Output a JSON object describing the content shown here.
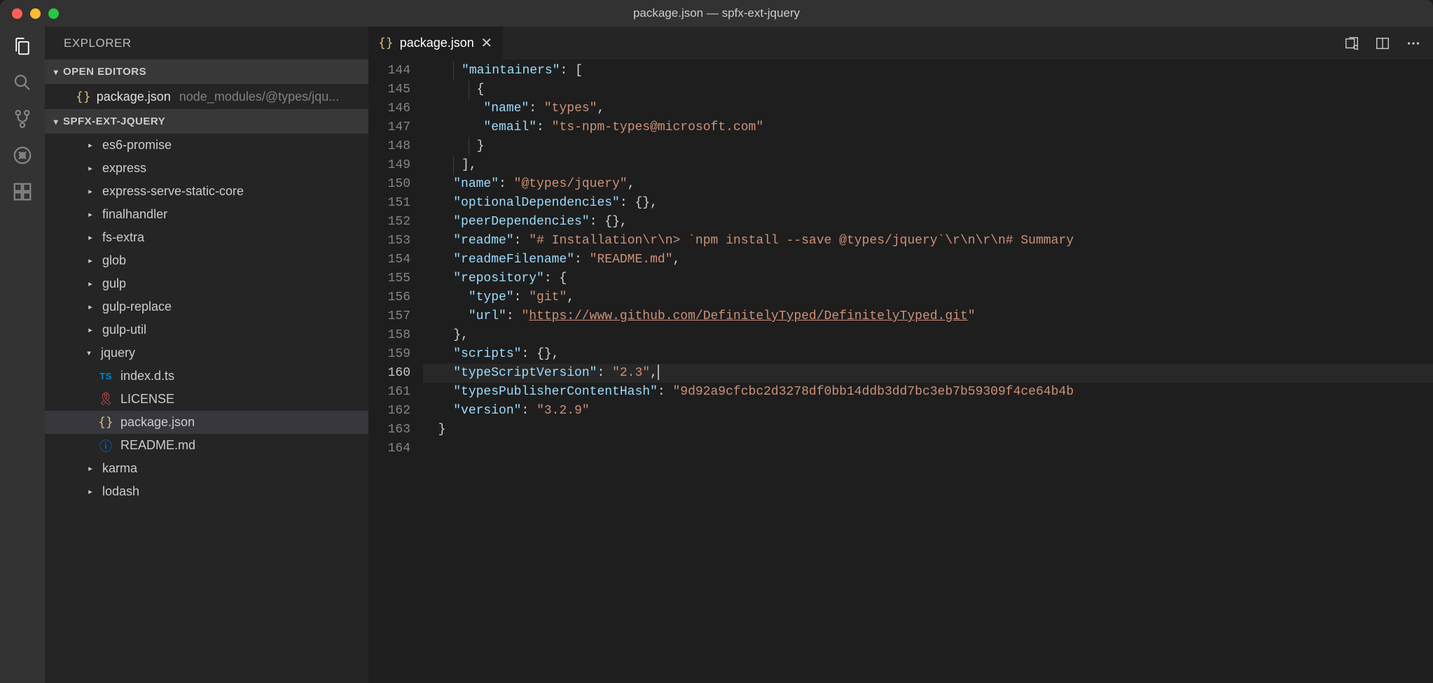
{
  "titlebar": {
    "title": "package.json — spfx-ext-jquery"
  },
  "sidebar": {
    "header": "EXPLORER",
    "openEditorsLabel": "OPEN EDITORS",
    "openEditors": [
      {
        "filename": "package.json",
        "path": "node_modules/@types/jqu..."
      }
    ],
    "projectLabel": "SPFX-EXT-JQUERY",
    "tree": [
      {
        "type": "folder",
        "label": "es6-promise",
        "expanded": false
      },
      {
        "type": "folder",
        "label": "express",
        "expanded": false
      },
      {
        "type": "folder",
        "label": "express-serve-static-core",
        "expanded": false
      },
      {
        "type": "folder",
        "label": "finalhandler",
        "expanded": false
      },
      {
        "type": "folder",
        "label": "fs-extra",
        "expanded": false
      },
      {
        "type": "folder",
        "label": "glob",
        "expanded": false
      },
      {
        "type": "folder",
        "label": "gulp",
        "expanded": false
      },
      {
        "type": "folder",
        "label": "gulp-replace",
        "expanded": false
      },
      {
        "type": "folder",
        "label": "gulp-util",
        "expanded": false
      },
      {
        "type": "folder",
        "label": "jquery",
        "expanded": true
      },
      {
        "type": "file-ts",
        "label": "index.d.ts",
        "selected": false
      },
      {
        "type": "file-license",
        "label": "LICENSE",
        "selected": false
      },
      {
        "type": "file-json",
        "label": "package.json",
        "selected": true
      },
      {
        "type": "file-info",
        "label": "README.md",
        "selected": false
      },
      {
        "type": "folder",
        "label": "karma",
        "expanded": false
      },
      {
        "type": "folder",
        "label": "lodash",
        "expanded": false
      }
    ]
  },
  "tab": {
    "filename": "package.json"
  },
  "editor": {
    "startLine": 144,
    "endLine": 164,
    "currentLine": 160,
    "lines": [
      {
        "n": 144,
        "tokens": [
          {
            "t": "pad",
            "w": 2
          },
          {
            "t": "guide"
          },
          {
            "t": "key",
            "v": "\"maintainers\""
          },
          {
            "t": "punc",
            "v": ":"
          },
          {
            "t": "sp",
            "v": " "
          },
          {
            "t": "punc",
            "v": "["
          }
        ]
      },
      {
        "n": 145,
        "tokens": [
          {
            "t": "pad",
            "w": 3
          },
          {
            "t": "guide"
          },
          {
            "t": "punc",
            "v": "{"
          }
        ]
      },
      {
        "n": 146,
        "tokens": [
          {
            "t": "pad",
            "w": 4
          },
          {
            "t": "key",
            "v": "\"name\""
          },
          {
            "t": "punc",
            "v": ":"
          },
          {
            "t": "sp",
            "v": " "
          },
          {
            "t": "str",
            "v": "\"types\""
          },
          {
            "t": "punc",
            "v": ","
          }
        ]
      },
      {
        "n": 147,
        "tokens": [
          {
            "t": "pad",
            "w": 4
          },
          {
            "t": "key",
            "v": "\"email\""
          },
          {
            "t": "punc",
            "v": ":"
          },
          {
            "t": "sp",
            "v": " "
          },
          {
            "t": "str",
            "v": "\"ts-npm-types@microsoft.com\""
          }
        ]
      },
      {
        "n": 148,
        "tokens": [
          {
            "t": "pad",
            "w": 3
          },
          {
            "t": "guide"
          },
          {
            "t": "punc",
            "v": "}"
          }
        ]
      },
      {
        "n": 149,
        "tokens": [
          {
            "t": "pad",
            "w": 2
          },
          {
            "t": "guide"
          },
          {
            "t": "punc",
            "v": "],"
          }
        ]
      },
      {
        "n": 150,
        "tokens": [
          {
            "t": "pad",
            "w": 2
          },
          {
            "t": "key",
            "v": "\"name\""
          },
          {
            "t": "punc",
            "v": ":"
          },
          {
            "t": "sp",
            "v": " "
          },
          {
            "t": "str",
            "v": "\"@types/jquery\""
          },
          {
            "t": "punc",
            "v": ","
          }
        ]
      },
      {
        "n": 151,
        "tokens": [
          {
            "t": "pad",
            "w": 2
          },
          {
            "t": "key",
            "v": "\"optionalDependencies\""
          },
          {
            "t": "punc",
            "v": ":"
          },
          {
            "t": "sp",
            "v": " "
          },
          {
            "t": "punc",
            "v": "{},"
          }
        ]
      },
      {
        "n": 152,
        "tokens": [
          {
            "t": "pad",
            "w": 2
          },
          {
            "t": "key",
            "v": "\"peerDependencies\""
          },
          {
            "t": "punc",
            "v": ":"
          },
          {
            "t": "sp",
            "v": " "
          },
          {
            "t": "punc",
            "v": "{},"
          }
        ]
      },
      {
        "n": 153,
        "tokens": [
          {
            "t": "pad",
            "w": 2
          },
          {
            "t": "key",
            "v": "\"readme\""
          },
          {
            "t": "punc",
            "v": ":"
          },
          {
            "t": "sp",
            "v": " "
          },
          {
            "t": "str",
            "v": "\"# Installation\\r\\n> `npm install --save @types/jquery`\\r\\n\\r\\n# Summary"
          }
        ]
      },
      {
        "n": 154,
        "tokens": [
          {
            "t": "pad",
            "w": 2
          },
          {
            "t": "key",
            "v": "\"readmeFilename\""
          },
          {
            "t": "punc",
            "v": ":"
          },
          {
            "t": "sp",
            "v": " "
          },
          {
            "t": "str",
            "v": "\"README.md\""
          },
          {
            "t": "punc",
            "v": ","
          }
        ]
      },
      {
        "n": 155,
        "tokens": [
          {
            "t": "pad",
            "w": 2
          },
          {
            "t": "key",
            "v": "\"repository\""
          },
          {
            "t": "punc",
            "v": ":"
          },
          {
            "t": "sp",
            "v": " "
          },
          {
            "t": "punc",
            "v": "{"
          }
        ]
      },
      {
        "n": 156,
        "tokens": [
          {
            "t": "pad",
            "w": 3
          },
          {
            "t": "key",
            "v": "\"type\""
          },
          {
            "t": "punc",
            "v": ":"
          },
          {
            "t": "sp",
            "v": " "
          },
          {
            "t": "str",
            "v": "\"git\""
          },
          {
            "t": "punc",
            "v": ","
          }
        ]
      },
      {
        "n": 157,
        "tokens": [
          {
            "t": "pad",
            "w": 3
          },
          {
            "t": "key",
            "v": "\"url\""
          },
          {
            "t": "punc",
            "v": ":"
          },
          {
            "t": "sp",
            "v": " "
          },
          {
            "t": "str",
            "v": "\""
          },
          {
            "t": "link",
            "v": "https://www.github.com/DefinitelyTyped/DefinitelyTyped.git"
          },
          {
            "t": "str",
            "v": "\""
          }
        ]
      },
      {
        "n": 158,
        "tokens": [
          {
            "t": "pad",
            "w": 2
          },
          {
            "t": "punc",
            "v": "},"
          }
        ]
      },
      {
        "n": 159,
        "tokens": [
          {
            "t": "pad",
            "w": 2
          },
          {
            "t": "key",
            "v": "\"scripts\""
          },
          {
            "t": "punc",
            "v": ":"
          },
          {
            "t": "sp",
            "v": " "
          },
          {
            "t": "punc",
            "v": "{},"
          }
        ]
      },
      {
        "n": 160,
        "tokens": [
          {
            "t": "pad",
            "w": 2
          },
          {
            "t": "key",
            "v": "\"typeScriptVersion\""
          },
          {
            "t": "punc",
            "v": ":"
          },
          {
            "t": "sp",
            "v": " "
          },
          {
            "t": "str",
            "v": "\"2.3\""
          },
          {
            "t": "punc",
            "v": ","
          },
          {
            "t": "cursor"
          }
        ]
      },
      {
        "n": 161,
        "tokens": [
          {
            "t": "pad",
            "w": 2
          },
          {
            "t": "key",
            "v": "\"typesPublisherContentHash\""
          },
          {
            "t": "punc",
            "v": ":"
          },
          {
            "t": "sp",
            "v": " "
          },
          {
            "t": "str",
            "v": "\"9d92a9cfcbc2d3278df0bb14ddb3dd7bc3eb7b59309f4ce64b4b"
          }
        ]
      },
      {
        "n": 162,
        "tokens": [
          {
            "t": "pad",
            "w": 2
          },
          {
            "t": "key",
            "v": "\"version\""
          },
          {
            "t": "punc",
            "v": ":"
          },
          {
            "t": "sp",
            "v": " "
          },
          {
            "t": "str",
            "v": "\"3.2.9\""
          }
        ]
      },
      {
        "n": 163,
        "tokens": [
          {
            "t": "pad",
            "w": 1
          },
          {
            "t": "punc",
            "v": "}"
          }
        ]
      },
      {
        "n": 164,
        "tokens": []
      }
    ]
  }
}
